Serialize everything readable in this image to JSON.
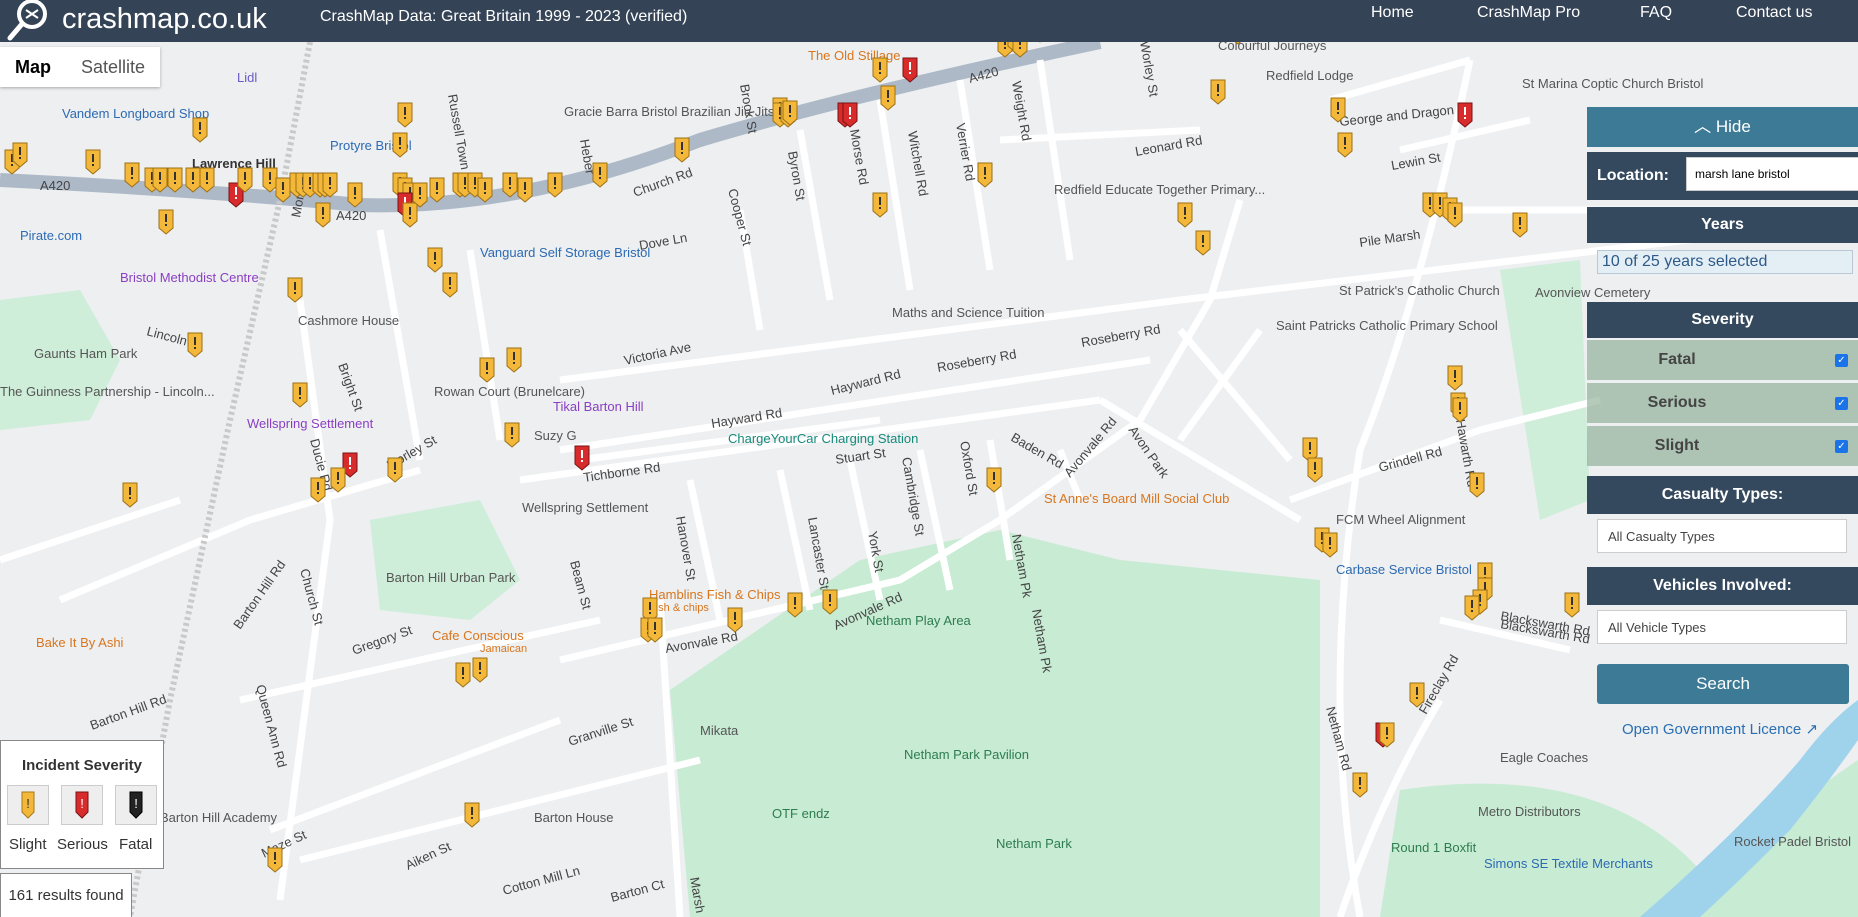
{
  "header": {
    "logo_text": "crashmap.co.uk",
    "subtitle": "CrashMap Data: Great Britain 1999 - 2023 (verified)",
    "nav": [
      {
        "label": "Home"
      },
      {
        "label": "CrashMap Pro"
      },
      {
        "label": "FAQ"
      },
      {
        "label": "Contact us"
      }
    ]
  },
  "map_toggle": {
    "map": "Map",
    "satellite": "Satellite"
  },
  "panel": {
    "hide": "Hide",
    "location_label": "Location:",
    "location_value": "marsh lane bristol",
    "years_header": "Years",
    "years_selected": "10 of 25 years selected",
    "severity_header": "Severity",
    "severity_options": [
      "Fatal",
      "Serious",
      "Slight"
    ],
    "casualty_header": "Casualty Types:",
    "casualty_value": "All Casualty Types",
    "vehicles_header": "Vehicles Involved:",
    "vehicles_value": "All Vehicle Types",
    "search": "Search",
    "licence": "Open Government Licence"
  },
  "legend": {
    "title": "Incident Severity",
    "items": [
      "Slight",
      "Serious",
      "Fatal"
    ],
    "colors": {
      "slight": "#f3b73a",
      "serious": "#d82b2b",
      "fatal": "#222222"
    }
  },
  "results": "161 results found",
  "map_labels": {
    "roads": [
      "A420",
      "A420",
      "A420",
      "Church Rd",
      "Victoria Ave",
      "Hayward Rd",
      "Hayward Rd",
      "Roseberry Rd",
      "Roseberry Rd",
      "Stuart St",
      "Tichborne Rd",
      "Avonvale Rd",
      "Avonvale Rd",
      "Avonvale Rd",
      "Avon Park",
      "Baden Rd",
      "Grindell Rd",
      "Blackswarth Rd",
      "Fireclay Rd",
      "Netham Rd",
      "Netham Pk",
      "Netham Pk",
      "Pile Marsh",
      "Leonard Rd",
      "Lewin St",
      "George and Dragon",
      "Morse Rd",
      "Witchell Rd",
      "Verrier Rd",
      "Weight Rd",
      "Byron St",
      "Cooper St",
      "Brook St",
      "Dove Ln",
      "Russell Town",
      "Morton",
      "Lincoln",
      "Ducie Rd",
      "Morley St",
      "Bright St",
      "Church St",
      "Barton Hill Rd",
      "Barton Hill Rd",
      "Queen Ann Rd",
      "Gregory St",
      "Beam St",
      "Hanover St",
      "Lancaster St",
      "York St",
      "Cambridge St",
      "Oxford St",
      "Granville St",
      "Maze St",
      "Aiken St",
      "Cotton Mill Ln",
      "Barton Ct",
      "Marsh",
      "Heber",
      "Worley St",
      "Blackswarth Rd",
      "Hawarth Rd"
    ],
    "pois": [
      "Lidl",
      "Vandem Longboard Shop",
      "Lawrence Hill",
      "Protyre Bristol",
      "Gracie Barra Bristol Brazilian Jiu Jitsu",
      "The Old Stillage",
      "Redfield Lodge",
      "St Marina Coptic Church Bristol",
      "Redfield Educate Together Primary...",
      "Pirate.com",
      "Vanguard Self Storage Bristol",
      "Bristol Methodist Centre",
      "Cashmore House",
      "Gaunts Ham Park",
      "The Guinness Partnership - Lincoln...",
      "Rowan Court (Brunelcare)",
      "Tikal Barton Hill",
      "Maths and Science Tuition",
      "St Patrick's Catholic Church",
      "Saint Patricks Catholic Primary School",
      "Wellspring Settlement",
      "Suzy G",
      "ChargeYourCar Charging Station",
      "Wellspring Settlement",
      "St Anne's Board Mill Social Club",
      "FCM Wheel Alignment",
      "Carbase Service Bristol",
      "Barton Hill Urban Park",
      "Hamblins Fish & Chips",
      "Fish & chips",
      "Cafe Conscious",
      "Jamaican",
      "Netham Play Area",
      "Bake It By Ashi",
      "Mikata",
      "Netham Park Pavilion",
      "Barton House",
      "OTF endz",
      "Netham Park",
      "Eagle Coaches",
      "Metro Distributors",
      "Round 1 Boxfit",
      "Simons SE Textile Merchants",
      "Rocket Padel Bristol",
      "Avonview Cemetery",
      "Colourful Journeys",
      "Barton Hill Academy"
    ]
  }
}
